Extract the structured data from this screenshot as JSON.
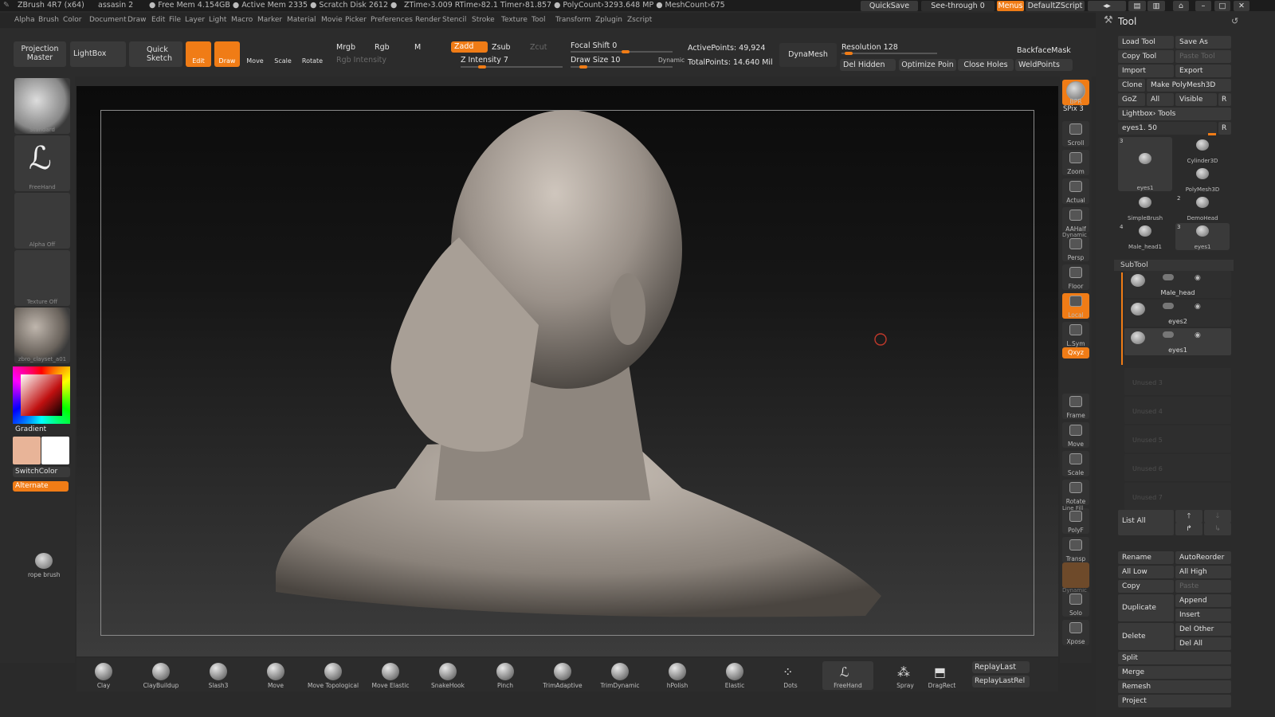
{
  "titlebar": {
    "app": "ZBrush 4R7 (x64)",
    "file": "assasin 2",
    "stats": "● Free Mem 4.154GB ● Active Mem 2335 ● Scratch Disk 2612 ●",
    "timing": "ZTime›3.009 RTime›82.1 Timer›81.857 ● PolyCount›3293.648 MP ● MeshCount›675",
    "quicksave": "QuickSave",
    "seethrough": "See-through  0",
    "menus": "Menus",
    "script": "DefaultZScript"
  },
  "menubar": [
    "Alpha",
    "Brush",
    "Color",
    "Document",
    "Draw",
    "Edit",
    "File",
    "Layer",
    "Light",
    "Macro",
    "Marker",
    "Material",
    "Movie",
    "Picker",
    "Preferences",
    "Render",
    "Stencil",
    "Stroke",
    "Texture",
    "Tool",
    "Transform",
    "Zplugin",
    "Zscript"
  ],
  "topshelf": {
    "projection_master": "Projection Master",
    "lightbox": "LightBox",
    "quick_sketch": "Quick Sketch",
    "edit": "Edit",
    "draw": "Draw",
    "move": "Move",
    "scale": "Scale",
    "rotate": "Rotate",
    "mrgb": "Mrgb",
    "rgb": "Rgb",
    "m": "M",
    "rgb_intensity": "Rgb Intensity",
    "zadd": "Zadd",
    "zsub": "Zsub",
    "zcut": "Zcut",
    "z_intensity": "Z Intensity 7",
    "focal_shift": "Focal Shift 0",
    "draw_size": "Draw Size 10",
    "dynamic": "Dynamic",
    "active_points": "ActivePoints: 49,924",
    "total_points": "TotalPoints: 14.640 Mil",
    "dynamesh": "DynaMesh",
    "resolution": "Resolution 128",
    "del_hidden": "Del Hidden",
    "optimize": "Optimize Poin",
    "close_holes": "Close Holes",
    "backface": "BackfaceMask",
    "weldpoints": "WeldPoints"
  },
  "leftshelf": {
    "standard": "Standard",
    "freehand": "FreeHand",
    "alpha_off": "Alpha Off",
    "texture_off": "Texture Off",
    "material": "zbro_clayset_a01",
    "gradient": "Gradient",
    "switchcolor": "SwitchColor",
    "alternate": "Alternate",
    "rope_brush": "rope brush",
    "swatch_main": "#e8b498",
    "swatch_secondary": "#ffffff"
  },
  "rightstrip": {
    "bpr": "BPR",
    "spix": "SPix 3",
    "scroll": "Scroll",
    "zoom": "Zoom",
    "actual": "Actual",
    "aahalf": "AAHalf",
    "dynamic_persp": "Dynamic",
    "persp": "Persp",
    "floor": "Floor",
    "local": "Local",
    "lsym": "L.Sym",
    "xyz": "Qxyz",
    "frame": "Frame",
    "move": "Move",
    "scale": "Scale",
    "rotate": "Rotate",
    "line_fill": "Line Fill",
    "polyf": "PolyF",
    "transp": "Transp",
    "dynamic_solo": "Dynamic",
    "solo": "Solo",
    "xpose": "Xpose"
  },
  "bottomshelf": {
    "brushes": [
      "Clay",
      "ClayBuildup",
      "Slash3",
      "Move",
      "Move Topological",
      "Move Elastic",
      "SnakeHook",
      "Pinch",
      "TrimAdaptive",
      "TrimDynamic",
      "hPolish",
      "Elastic"
    ],
    "dots": "Dots",
    "freehand": "FreeHand",
    "spray": "Spray",
    "dragrect": "DragRect",
    "replaylast": "ReplayLast",
    "replaylastrel": "ReplayLastRel"
  },
  "toolpanel": {
    "title": "Tool",
    "load_tool": "Load Tool",
    "save_as": "Save As",
    "copy_tool": "Copy Tool",
    "paste_tool": "Paste Tool",
    "import": "Import",
    "export": "Export",
    "clone": "Clone",
    "make_polymesh": "Make PolyMesh3D",
    "goz": "GoZ",
    "all": "All",
    "visible": "Visible",
    "r": "R",
    "lightbox_tools": "Lightbox› Tools",
    "current_tool": "eyes1. 50",
    "tool_items": [
      {
        "name": "eyes1",
        "count": "3"
      },
      {
        "name": "Cylinder3D",
        "count": ""
      },
      {
        "name": "PolyMesh3D",
        "count": ""
      },
      {
        "name": "SimpleBrush",
        "count": ""
      },
      {
        "name": "DemoHead",
        "count": "2"
      },
      {
        "name": "Male_head1",
        "count": "4"
      },
      {
        "name": "eyes1",
        "count": "3"
      }
    ],
    "subtool": "SubTool",
    "subtools": [
      "Male_head",
      "eyes2",
      "eyes1"
    ],
    "unused": [
      "Unused 3",
      "Unused 4",
      "Unused 5",
      "Unused 6",
      "Unused 7"
    ],
    "list_all": "List  All",
    "rename": "Rename",
    "autoreorder": "AutoReorder",
    "all_low": "All Low",
    "all_high": "All High",
    "copy": "Copy",
    "paste": "Paste",
    "duplicate": "Duplicate",
    "append": "Append",
    "insert": "Insert",
    "delete": "Delete",
    "del_other": "Del Other",
    "del_all": "Del All",
    "split": "Split",
    "merge": "Merge",
    "remesh": "Remesh",
    "project": "Project"
  },
  "colors": {
    "accent": "#f07c16",
    "panel": "#2b2b2b",
    "button": "#3a3a3a"
  }
}
